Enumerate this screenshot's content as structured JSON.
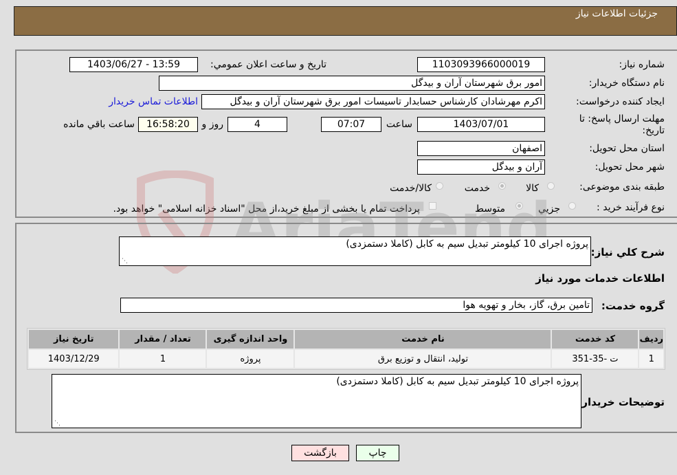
{
  "header": {
    "title": "جزئیات اطلاعات نیاز"
  },
  "fields": {
    "need_number_label": "شماره نیاز:",
    "need_number": "1103093966000019",
    "announce_label": "تاریخ و ساعت اعلان عمومي:",
    "announce_value": "1403/06/27 - 13:59",
    "buyer_org_label": "نام دستگاه خریدار:",
    "buyer_org": "امور برق شهرستان آران و بیدگل",
    "creator_label": "ایجاد کننده درخواست:",
    "creator": "اکرم مهرشادان کارشناس حسابدار تاسیسات امور برق شهرستان آران و بیدگل",
    "contact_link": "اطلاعات تماس خریدار",
    "deadline_label": "مهلت ارسال پاسخ: تا تاریخ:",
    "deadline_date": "1403/07/01",
    "time_label": "ساعت",
    "deadline_time": "07:07",
    "days_value": "4",
    "days_label": "روز و",
    "remaining_time": "16:58:20",
    "remaining_label": "ساعت باقي مانده",
    "province_label": "استان محل تحویل:",
    "province": "اصفهان",
    "city_label": "شهر محل تحویل:",
    "city": "آران و بیدگل",
    "category_label": "طبقه بندی موضوعی:",
    "category_options": [
      {
        "label": "کالا",
        "selected": false
      },
      {
        "label": "خدمت",
        "selected": true
      },
      {
        "label": "کالا/خدمت",
        "selected": false
      }
    ],
    "process_label": "نوع فرآیند خرید :",
    "process_options": [
      {
        "label": "جزيي",
        "selected": false
      },
      {
        "label": "متوسط",
        "selected": true
      }
    ],
    "treasury_note": "پرداخت تمام یا بخشی از مبلغ خرید،از محل \"اسناد خزانه اسلامی\" خواهد بود.",
    "treasury_checked": false
  },
  "details": {
    "summary_label": "شرح کلي نیاز:",
    "summary": "پروژه اجرای 10 کیلومتر تبدیل سیم به کابل (کاملا دستمزدی)",
    "services_heading": "اطلاعات خدمات مورد نیاز",
    "group_label": "گروه خدمت:",
    "group_value": "تامین برق، گاز، بخار و تهویه هوا",
    "table": {
      "headers": [
        "ردیف",
        "کد خدمت",
        "نام خدمت",
        "واحد اندازه گیری",
        "تعداد / مقدار",
        "تاریخ نیاز"
      ],
      "rows": [
        [
          "1",
          "ت -35-351",
          "تولید، انتقال و توزیع برق",
          "پروژه",
          "1",
          "1403/12/29"
        ]
      ]
    },
    "buyer_notes_label": "توضیحات خریدار:",
    "buyer_notes": "پروژه اجرای 10 کیلومتر تبدیل سیم به کابل (کاملا دستمزدی)"
  },
  "buttons": {
    "print": "چاپ",
    "back": "بازگشت"
  },
  "watermark": "AriaTender.neT",
  "colors": {
    "header_bg": "#8b6d44",
    "print_bg": "#eaffea",
    "back_bg": "#ffe0e0",
    "link": "#1a1ad8"
  }
}
